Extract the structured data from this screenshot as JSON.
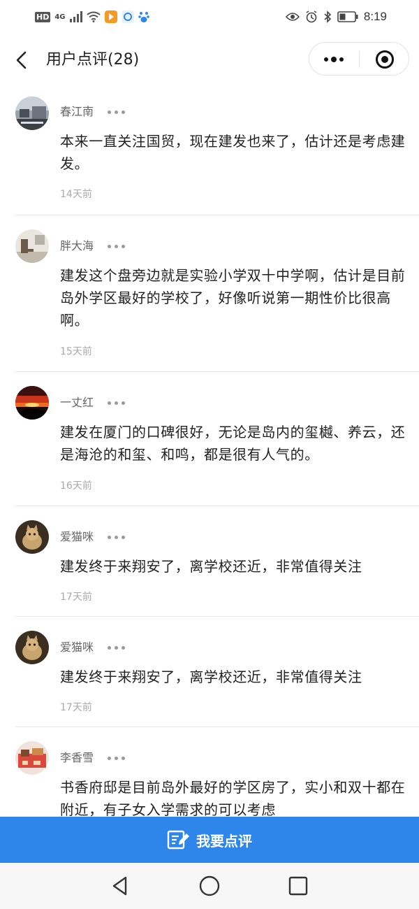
{
  "status_bar": {
    "hd": "HD",
    "network": "4G",
    "time": "8:19",
    "icons": [
      "signal-icon",
      "wifi-icon",
      "video-app-icon",
      "browser-app-icon",
      "baidu-app-icon",
      "eye-icon",
      "alarm-icon",
      "bluetooth-icon",
      "battery-icon"
    ]
  },
  "header": {
    "title": "用户点评(28)",
    "back_icon": "chevron-left-icon",
    "more_icon": "more-dots-icon",
    "close_icon": "target-close-icon"
  },
  "reviews": [
    {
      "user": "春江南",
      "text": "本来一直关注国贸，现在建发也来了，估计还是考虑建发。",
      "time": "14天前"
    },
    {
      "user": "胖大海",
      "text": "建发这个盘旁边就是实验小学双十中学啊，估计是目前岛外学区最好的学校了，好像听说第一期性价比很高啊。",
      "time": "15天前"
    },
    {
      "user": "一丈红",
      "text": "建发在厦门的口碑很好，无论是岛内的玺樾、养云，还是海沧的和玺、和鸣，都是很有人气的。",
      "time": "16天前"
    },
    {
      "user": "爱猫咪",
      "text": "建发终于来翔安了，离学校还近，非常值得关注",
      "time": "17天前"
    },
    {
      "user": "爱猫咪",
      "text": "建发终于来翔安了，离学校还近，非常值得关注",
      "time": "17天前"
    },
    {
      "user": "李香雪",
      "text": "书香府邸是目前岛外最好的学区房了，实小和双十都在附近，有子女入学需求的可以考虑",
      "time": ""
    }
  ],
  "bottom_button": {
    "label": "我要点评",
    "icon": "edit-note-icon"
  },
  "nav": {
    "back_icon": "triangle-back-icon",
    "home_icon": "circle-home-icon",
    "recents_icon": "square-recents-icon"
  },
  "colors": {
    "accent": "#2e86ea",
    "divider": "#e8e8e8",
    "time_text": "#aaaaaa",
    "username": "#666666"
  }
}
